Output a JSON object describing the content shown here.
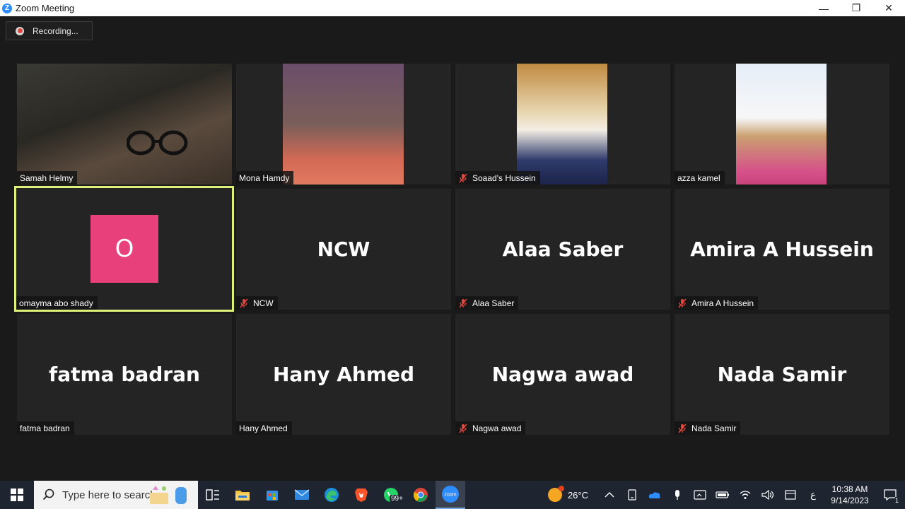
{
  "window": {
    "title": "Zoom Meeting",
    "app_icon_glyph": "Z",
    "minimize_glyph": "—",
    "restore_glyph": "❐",
    "close_glyph": "✕"
  },
  "recording": {
    "label": "Recording..."
  },
  "participants": [
    {
      "name": "Samah Helmy",
      "muted": false,
      "video": true
    },
    {
      "name": "Mona Hamdy",
      "muted": false,
      "video": true
    },
    {
      "name": "Soaad's Hussein",
      "muted": true,
      "video": true
    },
    {
      "name": "azza kamel",
      "muted": false,
      "video": true
    },
    {
      "name": "omayma abo shady",
      "muted": false,
      "video": false,
      "avatar_letter": "O",
      "avatar_color": "#e8407a",
      "active_speaker": true
    },
    {
      "name": "NCW",
      "muted": true,
      "video": false,
      "display_name": "NCW"
    },
    {
      "name": "Alaa Saber",
      "muted": true,
      "video": false,
      "display_name": "Alaa Saber"
    },
    {
      "name": "Amira A Hussein",
      "muted": true,
      "video": false,
      "display_name": "Amira A Hussein"
    },
    {
      "name": "fatma badran",
      "muted": false,
      "video": false,
      "display_name": "fatma badran"
    },
    {
      "name": "Hany Ahmed",
      "muted": false,
      "video": false,
      "display_name": "Hany Ahmed"
    },
    {
      "name": "Nagwa awad",
      "muted": true,
      "video": false,
      "display_name": "Nagwa awad"
    },
    {
      "name": "Nada Samir",
      "muted": true,
      "video": false,
      "display_name": "Nada Samir"
    }
  ],
  "taskbar": {
    "search_placeholder": "Type here to search",
    "whatsapp_badge": "99+",
    "pinned": [
      "task-view-icon",
      "file-explorer-icon",
      "microsoft-store-icon",
      "mail-icon",
      "edge-icon",
      "brave-icon",
      "whatsapp-icon",
      "chrome-icon",
      "zoom-icon"
    ],
    "active_app": "zoom-icon",
    "zoom_label": "zoom"
  },
  "tray": {
    "temperature": "26°C",
    "input_language": "ع",
    "time": "10:38 AM",
    "date": "9/14/2023",
    "notification_count": "1"
  },
  "colors": {
    "active_speaker_border": "#dff07a",
    "muted_icon": "#e0463d",
    "recording_dot": "#e0463d"
  }
}
